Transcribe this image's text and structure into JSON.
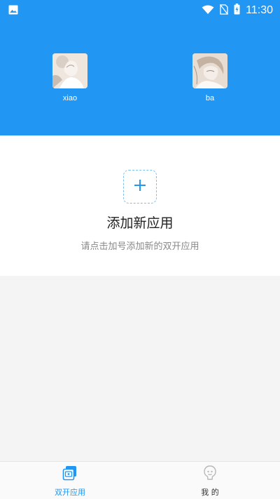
{
  "status_bar": {
    "time": "11:30",
    "icons": [
      "image-icon",
      "wifi-icon",
      "no-sim-icon",
      "battery-charging-icon"
    ]
  },
  "colors": {
    "primary": "#2196f3",
    "background": "#f4f4f4",
    "text_dark": "#222222",
    "text_muted": "#8a8a8a"
  },
  "apps": [
    {
      "label": "xiao",
      "icon": "app-avatar-icon"
    },
    {
      "label": "ba",
      "icon": "app-avatar-icon"
    }
  ],
  "add_panel": {
    "title": "添加新应用",
    "subtitle": "请点击加号添加新的双开应用",
    "icon": "plus-icon"
  },
  "bottom_nav": {
    "tabs": [
      {
        "label": "双开应用",
        "icon": "dual-apps-icon",
        "active": true
      },
      {
        "label": "我 的",
        "icon": "profile-icon",
        "active": false
      }
    ]
  }
}
